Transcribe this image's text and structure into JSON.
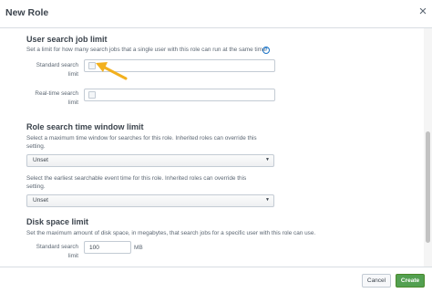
{
  "dialog": {
    "title": "New Role",
    "close_glyph": "×"
  },
  "job_limit": {
    "heading": "User search job limit",
    "description": "Set a limit for how many search jobs that a single user with this role can run at the same time",
    "info_glyph": "?",
    "standard_label_1": "Standard search",
    "standard_label_2": "limit",
    "standard_value": "",
    "realtime_label_1": "Real-time search",
    "realtime_label_2": "limit",
    "realtime_value": ""
  },
  "time_window": {
    "heading": "Role search time window limit",
    "description_1": "Select a maximum time window for searches for this role. Inherited roles can override this",
    "description_1b": "setting.",
    "select_1": "Unset",
    "description_2": "Select the earliest searchable event time for this role. Inherited roles can override this",
    "description_2b": "setting.",
    "select_2": "Unset"
  },
  "disk": {
    "heading": "Disk space limit",
    "description": "Set the maximum amount of disk space, in megabytes, that search jobs for a specific user with this role can use.",
    "label_1": "Standard search",
    "label_2": "limit",
    "value": "100",
    "unit": "MB"
  },
  "footer": {
    "cancel_label": "Cancel",
    "create_label": "Create"
  },
  "colors": {
    "primary": "#53a051",
    "arrow": "#f2b01e",
    "link": "#1a73c6"
  }
}
